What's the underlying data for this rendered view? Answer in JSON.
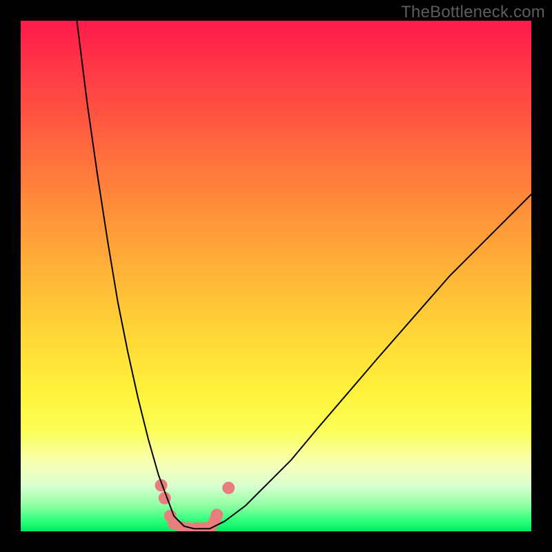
{
  "watermark": "TheBottleneck.com",
  "chart_data": {
    "type": "line",
    "title": "",
    "xlabel": "",
    "ylabel": "",
    "xlim": [
      0,
      100
    ],
    "ylim": [
      0,
      100
    ],
    "grid": false,
    "legend": false,
    "annotations": [],
    "background_gradient": {
      "axis": "y",
      "stops": [
        {
          "pos": 0,
          "color": "#00e865",
          "meaning": "optimal"
        },
        {
          "pos": 5,
          "color": "#8effa4",
          "meaning": "good"
        },
        {
          "pos": 13,
          "color": "#f6ffb8",
          "meaning": "borderline"
        },
        {
          "pos": 28,
          "color": "#fff03a",
          "meaning": "mild"
        },
        {
          "pos": 52,
          "color": "#ffb038",
          "meaning": "moderate"
        },
        {
          "pos": 78,
          "color": "#ff6040",
          "meaning": "high"
        },
        {
          "pos": 100,
          "color": "#ff1a4b",
          "meaning": "severe"
        }
      ]
    },
    "series": [
      {
        "name": "bottleneck-curve",
        "color": "#000000",
        "x": [
          11,
          13,
          15,
          17,
          19,
          21,
          23,
          25,
          27,
          28.5,
          30,
          32,
          34,
          37,
          40,
          44,
          48,
          53,
          58,
          64,
          70,
          77,
          84,
          92,
          100
        ],
        "y": [
          100,
          84,
          70,
          57,
          45,
          35,
          26,
          18,
          11,
          7,
          3,
          1,
          0.5,
          0.5,
          2,
          5,
          9,
          14,
          20,
          27,
          34,
          42,
          50,
          58,
          66
        ]
      }
    ],
    "markers": [
      {
        "name": "near-minimum-dots",
        "color": "#e77d7d",
        "radius": 9,
        "points": [
          {
            "x": 27.5,
            "y": 9
          },
          {
            "x": 28.2,
            "y": 6.5
          },
          {
            "x": 29.3,
            "y": 3
          },
          {
            "x": 30.0,
            "y": 1.5
          },
          {
            "x": 31.5,
            "y": 0.8
          },
          {
            "x": 33.0,
            "y": 0.6
          },
          {
            "x": 34.5,
            "y": 0.6
          },
          {
            "x": 36.0,
            "y": 0.6
          },
          {
            "x": 37.2,
            "y": 0.8
          },
          {
            "x": 38.0,
            "y": 2
          },
          {
            "x": 38.4,
            "y": 3.2
          },
          {
            "x": 40.7,
            "y": 8.5
          }
        ]
      }
    ]
  }
}
